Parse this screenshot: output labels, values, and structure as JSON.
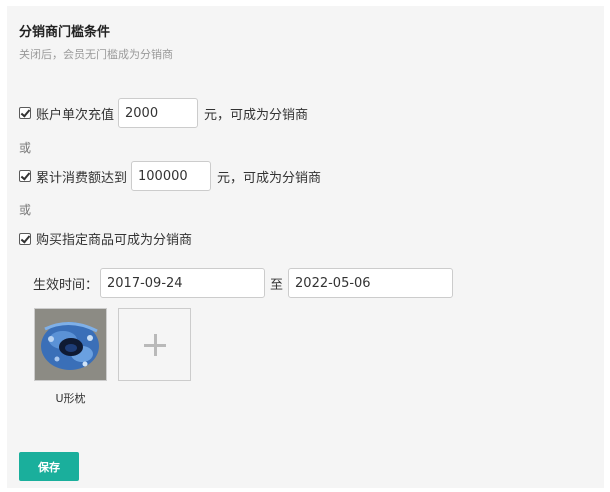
{
  "section": {
    "title": "分销商门槛条件",
    "subtitle": "关闭后，会员无门槛成为分销商"
  },
  "conditions": [
    {
      "checked": true,
      "label_before": "账户单次充值",
      "value": "2000",
      "label_after": "元，可成为分销商"
    },
    {
      "checked": true,
      "label_before": "累计消费额达到",
      "value": "100000",
      "label_after": "元，可成为分销商"
    },
    {
      "checked": true,
      "label_before": "购买指定商品可成为分销商"
    }
  ],
  "or_label": "或",
  "validity": {
    "label": "生效时间：",
    "start": "2017-09-24",
    "separator": "至",
    "end": "2022-05-06"
  },
  "products": [
    {
      "name": "U形枕",
      "thumb_icon": "u-pillow-image"
    }
  ],
  "add_product_icon": "plus-icon",
  "save_label": "保存",
  "colors": {
    "primary": "#1aaf9c",
    "panel_bg": "#f5f5f5",
    "muted_text": "#9a9a9a"
  }
}
